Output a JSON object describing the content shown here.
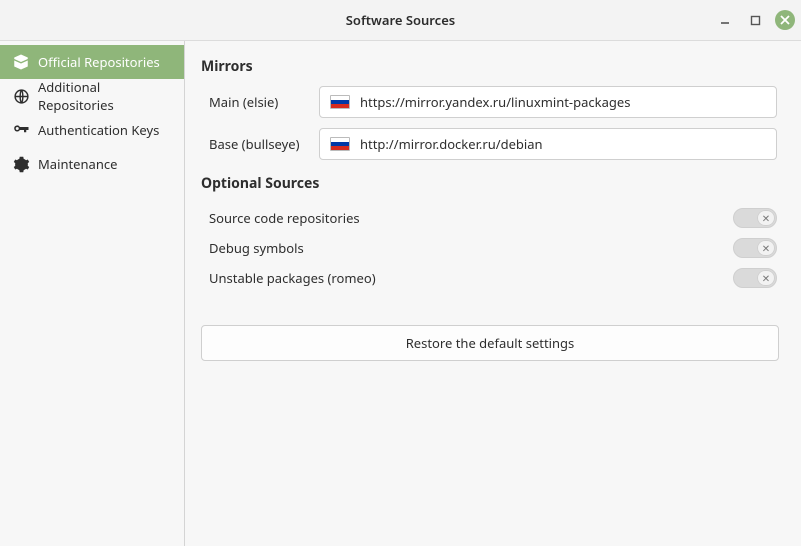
{
  "window": {
    "title": "Software Sources"
  },
  "sidebar": {
    "items": [
      {
        "id": "official",
        "label": "Official Repositories",
        "active": true
      },
      {
        "id": "additional",
        "label": "Additional Repositories",
        "active": false
      },
      {
        "id": "keys",
        "label": "Authentication Keys",
        "active": false
      },
      {
        "id": "maintenance",
        "label": "Maintenance",
        "active": false
      }
    ]
  },
  "main": {
    "mirrors": {
      "heading": "Mirrors",
      "main_label": "Main (elsie)",
      "main_value": "https://mirror.yandex.ru/linuxmint-packages",
      "base_label": "Base (bullseye)",
      "base_value": "http://mirror.docker.ru/debian"
    },
    "optional": {
      "heading": "Optional Sources",
      "rows": [
        {
          "label": "Source code repositories",
          "enabled": false
        },
        {
          "label": "Debug symbols",
          "enabled": false
        },
        {
          "label": "Unstable packages (romeo)",
          "enabled": false
        }
      ]
    },
    "restore_label": "Restore the default settings"
  }
}
